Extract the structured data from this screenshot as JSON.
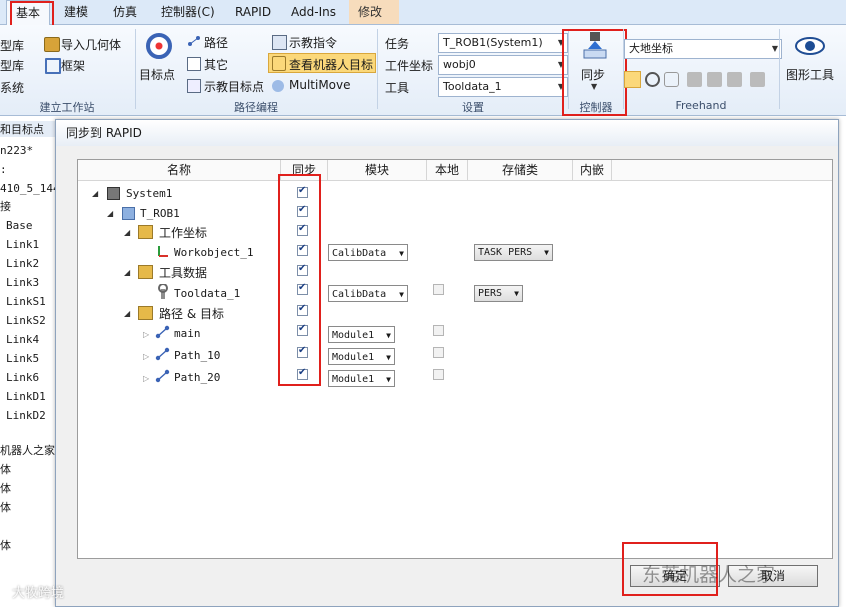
{
  "tabs": {
    "basic": "基本",
    "modeling": "建模",
    "simulation": "仿真",
    "controller": "控制器(C)",
    "rapid": "RAPID",
    "addins": "Add-Ins",
    "modify": "修改"
  },
  "ribbon": {
    "left_items": [
      "型库",
      "型库",
      "系统"
    ],
    "import_geometry": "导入几何体",
    "frame": "框架",
    "build_station": "建立工作站",
    "target_point": "目标点",
    "path": "路径",
    "other": "其它",
    "teach_target": "示教目标点",
    "teach_instruction": "示教指令",
    "view_robot_target": "查看机器人目标",
    "multimove": "MultiMove",
    "path_programming": "路径编程",
    "task_label": "任务",
    "task_value": "T_ROB1(System1)",
    "wobj_label": "工件坐标",
    "wobj_value": "wobj0",
    "tool_label": "工具",
    "tool_value": "Tooldata_1",
    "settings": "设置",
    "sync": "同步",
    "controller_group": "控制器",
    "coord_value": "大地坐标",
    "freehand": "Freehand",
    "graphics_tool": "图形工具"
  },
  "left_panel": {
    "tab_label": "和目标点",
    "items": [
      "n223*",
      ":",
      "410_5_144_",
      "接",
      "Base",
      "Link1",
      "Link2",
      "Link3",
      "LinkS1",
      "LinkS2",
      "Link4",
      "Link5",
      "Link6",
      "LinkD1",
      "LinkD2",
      "机器人之家",
      "体",
      "体",
      "体",
      "体"
    ]
  },
  "dialog": {
    "title": "同步到 RAPID",
    "columns": {
      "name": "名称",
      "sync": "同步",
      "module": "模块",
      "local": "本地",
      "storage": "存储类",
      "inline": "内嵌"
    },
    "rows": {
      "system": "System1",
      "trob": "T_ROB1",
      "workobjects": "工作坐标",
      "workobject1": "Workobject_1",
      "tooldata": "工具数据",
      "tooldata1": "Tooldata_1",
      "paths": "路径 & 目标",
      "main": "main",
      "path10": "Path_10",
      "path20": "Path_20"
    },
    "modules": {
      "wobj": "CalibData",
      "tool": "CalibData",
      "main": "Module1",
      "path10": "Module1",
      "path20": "Module1"
    },
    "storage": {
      "wobj": "TASK PERS",
      "tool": "PERS"
    },
    "ok_label": "确定",
    "cancel_label": "取消"
  },
  "watermark": {
    "main": "东莞机器人之家",
    "corner": "大牧跨境"
  },
  "colors": {
    "highlight": "#e0201c",
    "ribbon_bg": "#e4edf8",
    "selected_button": "#fbd87a"
  }
}
